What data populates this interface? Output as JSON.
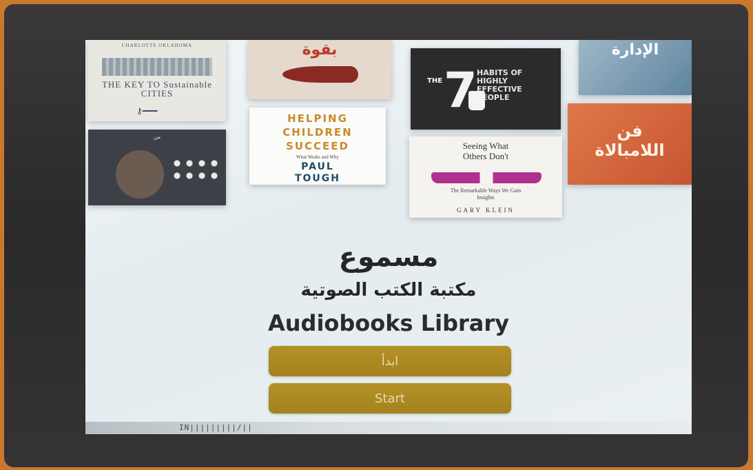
{
  "brand": {
    "name_ar": "مسموع"
  },
  "heading": {
    "ar": "مكتبة الكتب الصوتية",
    "en": "Audiobooks Library"
  },
  "buttons": {
    "start_ar": "ابدأ",
    "start_en": "Start"
  },
  "books": {
    "book1": {
      "top_text": "CHARLOTTE OKLAHOMA",
      "title": "THE KEY TO Sustainable CITIES"
    },
    "book2": {
      "title_ar": "بقوة"
    },
    "book3": {
      "the": "THE",
      "number": "7",
      "title": "HABITS OF HIGHLY EFFECTIVE PEOPLE"
    },
    "book4": {
      "title_ar": "الإدارة"
    },
    "book5": {
      "title_ar": "من"
    },
    "book6": {
      "title": "HELPING CHILDREN SUCCEED",
      "subtitle": "What Works and Why",
      "author": "PAUL TOUGH"
    },
    "book7": {
      "title": "Seeing What Others Don't",
      "subtitle": "The Remarkable Ways We Gain Insights",
      "author": "GARY KLEIN"
    },
    "book8": {
      "title_ar": "فن اللامبالاة"
    }
  },
  "status": {
    "code": "IN|||||||||/||"
  }
}
